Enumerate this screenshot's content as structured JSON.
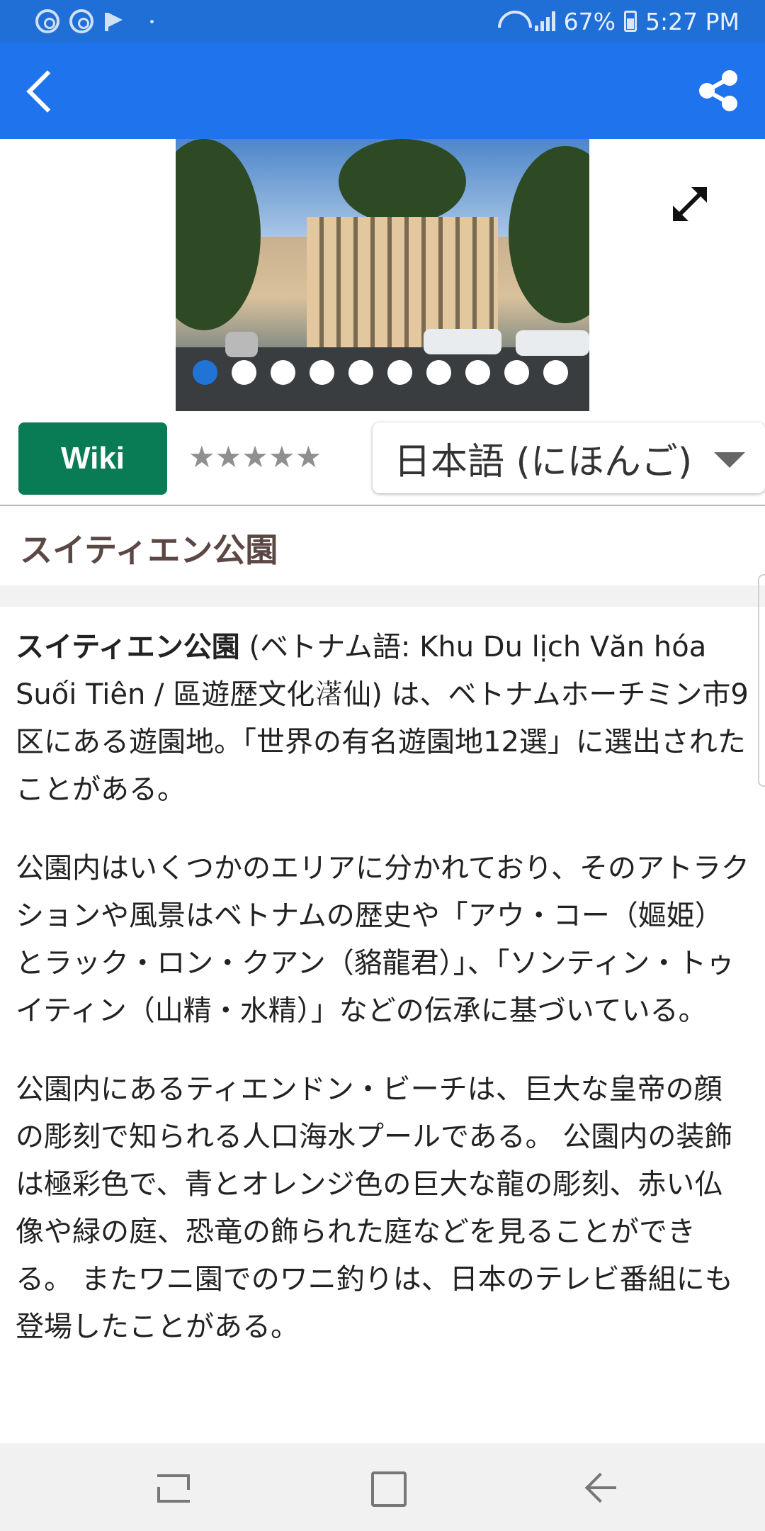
{
  "status_bar": {
    "battery": "67%",
    "time": "5:27 PM"
  },
  "app_bar": {
    "back_icon": "back-arrow-icon",
    "share_icon": "share-icon"
  },
  "gallery": {
    "image_description": "photo-thumbnail",
    "dot_count": 10,
    "active_dot": 0
  },
  "toolbar": {
    "wiki_label": "Wiki",
    "rating": 0,
    "rating_max": 5,
    "stars": "★★★★★",
    "language": "日本語 (にほんご)"
  },
  "title": "スイティエン公園",
  "article": {
    "p1_bold": "スイティエン公園",
    "p1_rest": " (ベトナム語: Khu Du lịch Văn hóa Suối Tiên / 區遊歴文化𤀞仙) は、ベトナムホーチミン市9区にある遊園地。「世界の有名遊園地12選」に選出されたことがある。",
    "p2": "公園内はいくつかのエリアに分かれており、そのアトラクションや風景はベトナムの歴史や「アウ・コー（嫗姫）とラック・ロン・クアン（貉龍君）」、「ソンティン・トゥイティン（山精・水精）」などの伝承に基づいている。",
    "p3": "公園内にあるティエンドン・ビーチは、巨大な皇帝の顔の彫刻で知られる人口海水プールである。 公園内の装飾は極彩色で、青とオレンジ色の巨大な龍の彫刻、赤い仏像や緑の庭、恐竜の飾られた庭などを見ることができる。 またワニ園でのワニ釣りは、日本のテレビ番組にも登場したことがある。"
  },
  "colors": {
    "status_bar": "#1f6fd6",
    "app_bar": "#1f74ee",
    "wiki_button": "#0a7c55",
    "active_dot": "#1f74d6",
    "title_text": "#5b4743"
  }
}
